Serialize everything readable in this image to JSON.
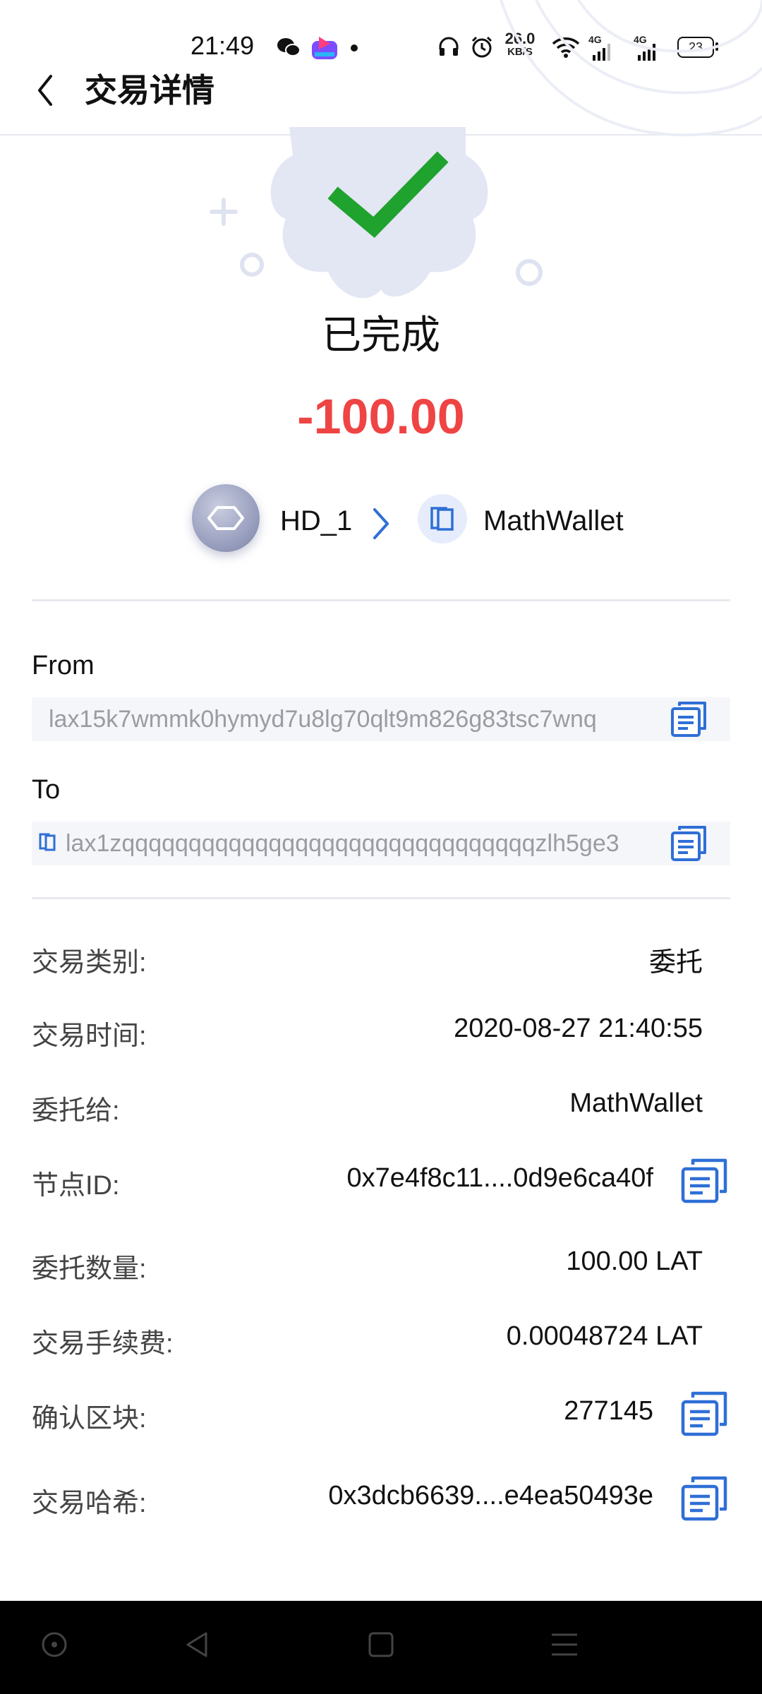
{
  "status_bar": {
    "time": "21:49",
    "net_speed": "26.0",
    "net_unit": "KB/S",
    "signal1": "4G",
    "signal2": "4G",
    "battery": "23",
    "icons": [
      "wechat-icon",
      "app-icon",
      "dot-icon",
      "headphones-icon",
      "alarm-icon",
      "wifi-icon",
      "signal-icon",
      "battery-icon"
    ]
  },
  "header": {
    "title": "交易详情",
    "back_icon": "chevron-left-icon"
  },
  "transaction": {
    "status": "已完成",
    "amount": "-100.00",
    "amount_color": "#ef4444",
    "from_name": "HD_1",
    "to_name": "MathWallet"
  },
  "addresses": {
    "from_label": "From",
    "from_value": "lax15k7wmmk0hymyd7u8lg70qlt9m826g83tsc7wnq",
    "to_label": "To",
    "to_value": "lax1zqqqqqqqqqqqqqqqqqqqqqqqqqqqqqqqzlh5ge3"
  },
  "details": [
    {
      "label": "交易类别:",
      "value": "委托"
    },
    {
      "label": "交易时间:",
      "value": "2020-08-27 21:40:55"
    },
    {
      "label": "委托给:",
      "value": "MathWallet"
    },
    {
      "label": "节点ID:",
      "value": "0x7e4f8c11....0d9e6ca40f"
    },
    {
      "label": "委托数量:",
      "value": "100.00 LAT"
    },
    {
      "label": "交易手续费:",
      "value": "0.00048724 LAT"
    },
    {
      "label": "确认区块:",
      "value": "277145"
    },
    {
      "label": "交易哈希:",
      "value": "0x3dcb6639....e4ea50493e"
    }
  ],
  "colors": {
    "accent_blue": "#2f6fd6",
    "success_green": "#1fa22e",
    "badge_bg": "#e3e6f3"
  }
}
